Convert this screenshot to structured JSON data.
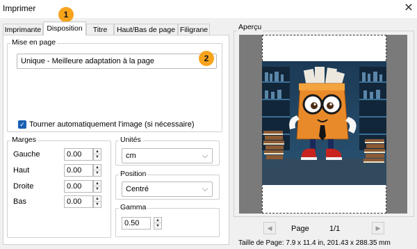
{
  "window": {
    "title": "Imprimer"
  },
  "tabs": [
    {
      "label": "Imprimante"
    },
    {
      "label": "Disposition"
    },
    {
      "label": "Titre"
    },
    {
      "label": "Haut/Bas de page"
    },
    {
      "label": "Filigrane"
    }
  ],
  "badges": {
    "one": "1",
    "two": "2"
  },
  "layout": {
    "group_label": "Mise en page",
    "mode_value": "Unique - Meilleure adaptation à la page",
    "rotate_label": "Tourner automatiquement l'image (si nécessaire)",
    "rotate_checked": true
  },
  "margins": {
    "group_label": "Marges",
    "rows": [
      {
        "label": "Gauche",
        "value": "0.00"
      },
      {
        "label": "Haut",
        "value": "0.00"
      },
      {
        "label": "Droite",
        "value": "0.00"
      },
      {
        "label": "Bas",
        "value": "0.00"
      }
    ]
  },
  "units": {
    "group_label": "Unités",
    "value": "cm"
  },
  "position": {
    "group_label": "Position",
    "value": "Centré"
  },
  "gamma": {
    "group_label": "Gamma",
    "value": "0.50"
  },
  "preview": {
    "group_label": "Aperçu",
    "page_label": "Page",
    "page_count": "1/1",
    "page_size": "Taille de Page: 7.9 x 11.4 in, 201.43 x 288.35 mm"
  },
  "colors": {
    "accent": "#1a5fb4",
    "badge": "#f7a41d"
  }
}
